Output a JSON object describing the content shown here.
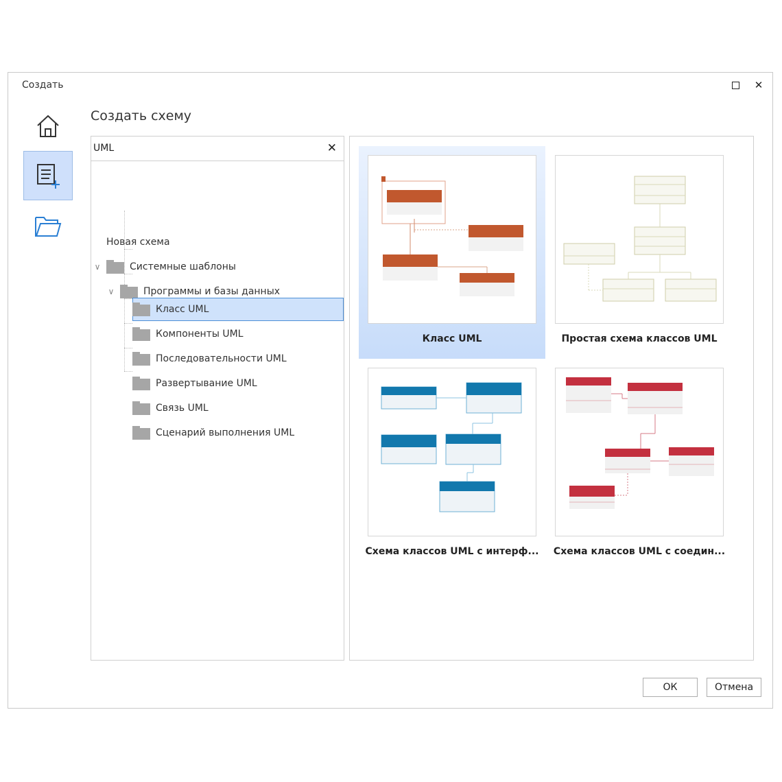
{
  "window": {
    "title": "Создать"
  },
  "heading": "Создать схему",
  "search": {
    "value": "UML"
  },
  "tree": {
    "new_schema": "Новая схема",
    "system_templates": "Системные шаблоны",
    "programs_db": "Программы и базы данных",
    "items": [
      "Класс UML",
      "Компоненты UML",
      "Последовательности UML",
      "Развертывание UML",
      "Связь UML",
      "Сценарий выполнения UML"
    ]
  },
  "templates": [
    {
      "label": "Класс UML",
      "accent": "#c1582e"
    },
    {
      "label": "Простая схема классов UML",
      "accent": "#d8d6b8"
    },
    {
      "label": "Схема классов UML с интерф...",
      "accent": "#1278ad"
    },
    {
      "label": "Схема классов UML с соедин...",
      "accent": "#c3303f"
    }
  ],
  "buttons": {
    "ok": "ОК",
    "cancel": "Отмена"
  }
}
